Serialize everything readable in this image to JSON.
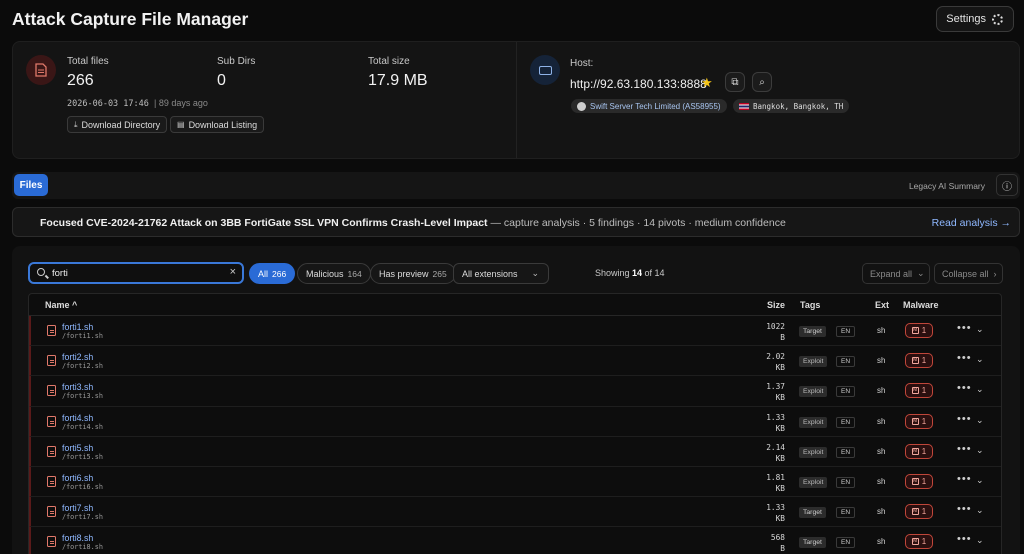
{
  "app": {
    "title": "Attack Capture File Manager",
    "settings_label": "Settings"
  },
  "summary": {
    "total_files_label": "Total files",
    "total_files": "266",
    "sub_dirs_label": "Sub Dirs",
    "sub_dirs": "0",
    "total_size_label": "Total size",
    "total_size": "17.9 MB",
    "timestamp": "2026-06-03 17:46",
    "age": "| 89 days ago",
    "download_directory": "Download Directory",
    "download_listing": "Download Listing",
    "host_label": "Host:",
    "host_url": "http://92.63.180.133:8888",
    "asn": "Swift Server Tech Limited (AS58955)",
    "location": "Bangkok, Bangkok, TH"
  },
  "tabs": {
    "files": "Files",
    "legacy": "Legacy AI Summary"
  },
  "analysis": {
    "headline": "Focused CVE-2024-21762 Attack on 3BB FortiGate SSL VPN Confirms Crash-Level Impact",
    "meta": " — capture analysis · 5 findings · 14 pivots · medium confidence",
    "read_link": "Read analysis →"
  },
  "filters": {
    "search_value": "forti",
    "all_label": "All",
    "all_count": "266",
    "malicious_label": "Malicious",
    "malicious_count": "164",
    "preview_label": "Has preview",
    "preview_count": "265",
    "ext_label": "All extensions",
    "showing_prefix": "Showing ",
    "showing_count": "14",
    "showing_suffix": " of 14",
    "expand_all": "Expand all",
    "collapse_all": "Collapse all"
  },
  "table": {
    "headers": {
      "name": "Name",
      "size": "Size",
      "tags": "Tags",
      "ext": "Ext",
      "malware": "Malware"
    },
    "rows": [
      {
        "name": "forti1.sh",
        "path": "/forti1.sh",
        "size_val": "1022",
        "size_unit": "B",
        "tag": "Target",
        "lang": "EN",
        "ext": "sh",
        "mw": "1"
      },
      {
        "name": "forti2.sh",
        "path": "/forti2.sh",
        "size_val": "2.02",
        "size_unit": "KB",
        "tag": "Exploit",
        "lang": "EN",
        "ext": "sh",
        "mw": "1"
      },
      {
        "name": "forti3.sh",
        "path": "/forti3.sh",
        "size_val": "1.37",
        "size_unit": "KB",
        "tag": "Exploit",
        "lang": "EN",
        "ext": "sh",
        "mw": "1"
      },
      {
        "name": "forti4.sh",
        "path": "/forti4.sh",
        "size_val": "1.33",
        "size_unit": "KB",
        "tag": "Exploit",
        "lang": "EN",
        "ext": "sh",
        "mw": "1"
      },
      {
        "name": "forti5.sh",
        "path": "/forti5.sh",
        "size_val": "2.14",
        "size_unit": "KB",
        "tag": "Exploit",
        "lang": "EN",
        "ext": "sh",
        "mw": "1"
      },
      {
        "name": "forti6.sh",
        "path": "/forti6.sh",
        "size_val": "1.81",
        "size_unit": "KB",
        "tag": "Exploit",
        "lang": "EN",
        "ext": "sh",
        "mw": "1"
      },
      {
        "name": "forti7.sh",
        "path": "/forti7.sh",
        "size_val": "1.33",
        "size_unit": "KB",
        "tag": "Target",
        "lang": "EN",
        "ext": "sh",
        "mw": "1"
      },
      {
        "name": "forti8.sh",
        "path": "/forti8.sh",
        "size_val": "568",
        "size_unit": "B",
        "tag": "Target",
        "lang": "EN",
        "ext": "sh",
        "mw": "1"
      }
    ]
  }
}
